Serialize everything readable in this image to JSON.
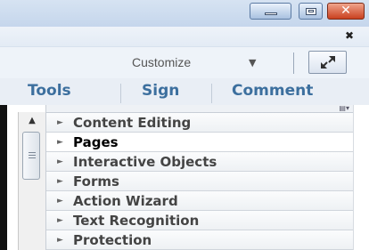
{
  "window": {
    "controls": {
      "minimize_icon": "minimize-icon",
      "maximize_icon": "maximize-icon",
      "close_icon": "close-icon",
      "close_glyph": "✕"
    }
  },
  "panel_close": {
    "glyph": "✖"
  },
  "toolbar": {
    "customize_label": "Customize",
    "customize_arrow": "▼"
  },
  "tabs": [
    {
      "label": "Tools"
    },
    {
      "label": "Sign"
    },
    {
      "label": "Comment"
    }
  ],
  "panel": {
    "items": [
      {
        "label": "Content Editing",
        "selected": false
      },
      {
        "label": "Pages",
        "selected": true
      },
      {
        "label": "Interactive Objects",
        "selected": false
      },
      {
        "label": "Forms",
        "selected": false
      },
      {
        "label": "Action Wizard",
        "selected": false
      },
      {
        "label": "Text Recognition",
        "selected": false
      },
      {
        "label": "Protection",
        "selected": false
      }
    ],
    "expand_arrow": "►",
    "scroll_up": "▲"
  },
  "colors": {
    "tab_text": "#3c6f9e",
    "close_button": "#c9401f"
  }
}
